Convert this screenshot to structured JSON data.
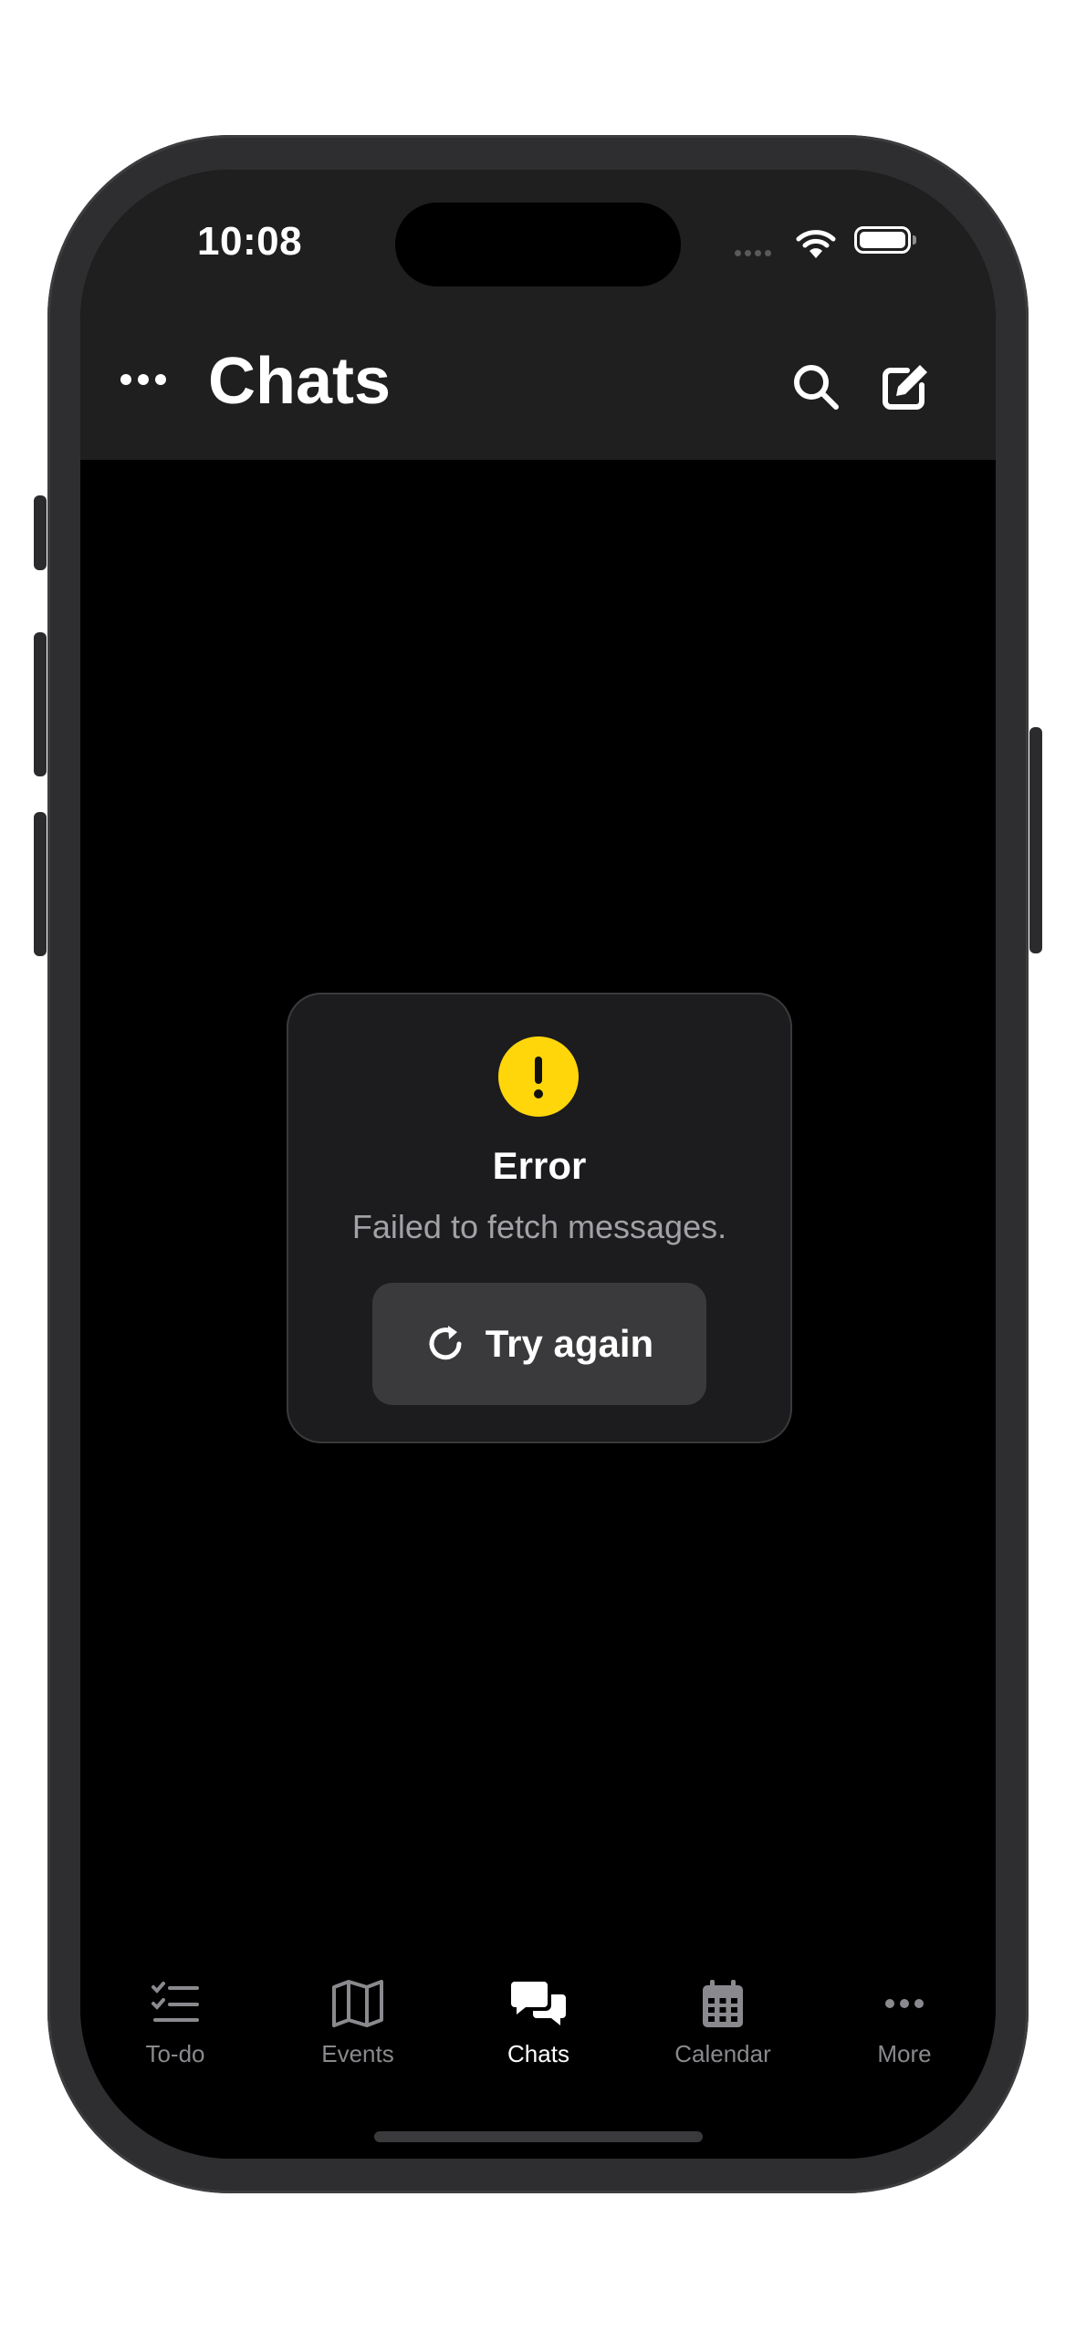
{
  "status_bar": {
    "time": "10:08"
  },
  "header": {
    "title": "Chats",
    "icons": [
      "more-horizontal-icon",
      "search-icon",
      "compose-icon"
    ]
  },
  "error_card": {
    "icon": "warning-icon",
    "title": "Error",
    "message": "Failed to fetch messages.",
    "retry_label": "Try again",
    "retry_icon": "refresh-icon",
    "accent": "#ffd60a"
  },
  "tabbar": {
    "items": [
      {
        "label": "To-do",
        "icon": "checklist-icon",
        "active": false
      },
      {
        "label": "Events",
        "icon": "map-icon",
        "active": false
      },
      {
        "label": "Chats",
        "icon": "chat-bubbles-icon",
        "active": true
      },
      {
        "label": "Calendar",
        "icon": "calendar-icon",
        "active": false
      },
      {
        "label": "More",
        "icon": "more-horizontal-icon",
        "active": false
      }
    ]
  },
  "colors": {
    "background": "#000000",
    "header": "#1f1f1f",
    "card": "#1c1c1e",
    "button": "#3a3a3c",
    "inactive_tab": "#8a8a8e"
  }
}
